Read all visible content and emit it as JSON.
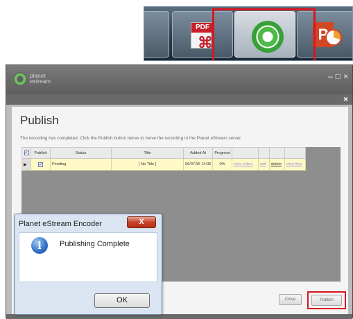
{
  "taskbar": {
    "pdf_label": "PDF",
    "ppt_letter": "P",
    "highlight_color": "#d6171f",
    "items": [
      {
        "name": "acrobat-pdf",
        "icon": "acrobat-pdf-icon"
      },
      {
        "name": "planet-estream-encoder",
        "icon": "estream-logo-icon",
        "active": true
      },
      {
        "name": "powerpoint",
        "icon": "powerpoint-icon"
      }
    ]
  },
  "app": {
    "brand_line1": "planet",
    "brand_line2": "estream",
    "win_minimize": "–",
    "win_maximize": "□",
    "win_close": "×",
    "panel_close": "×",
    "title": "Publish",
    "message": "The recording has completed.  Click the Publish button below to move the recording to the Planet eStream server.",
    "table": {
      "headers": [
        "",
        "Publish",
        "Status",
        "Title",
        "Added At",
        "Progress",
        "",
        "",
        "",
        ""
      ],
      "rows": [
        {
          "checked": "✓",
          "status": "Pending",
          "title": "[ No Title ]",
          "added_at": "06/07/15 14:06",
          "progress": "0%",
          "view_online": "view online",
          "edit": "edit",
          "delete": "delete",
          "view_files": "view files"
        }
      ]
    },
    "close_label": "Close",
    "publish_label": "Publish"
  },
  "dialog": {
    "title": "Planet eStream Encoder",
    "close_glyph": "X",
    "icon": "info-icon",
    "message": "Publishing Complete",
    "ok_label": "OK"
  }
}
